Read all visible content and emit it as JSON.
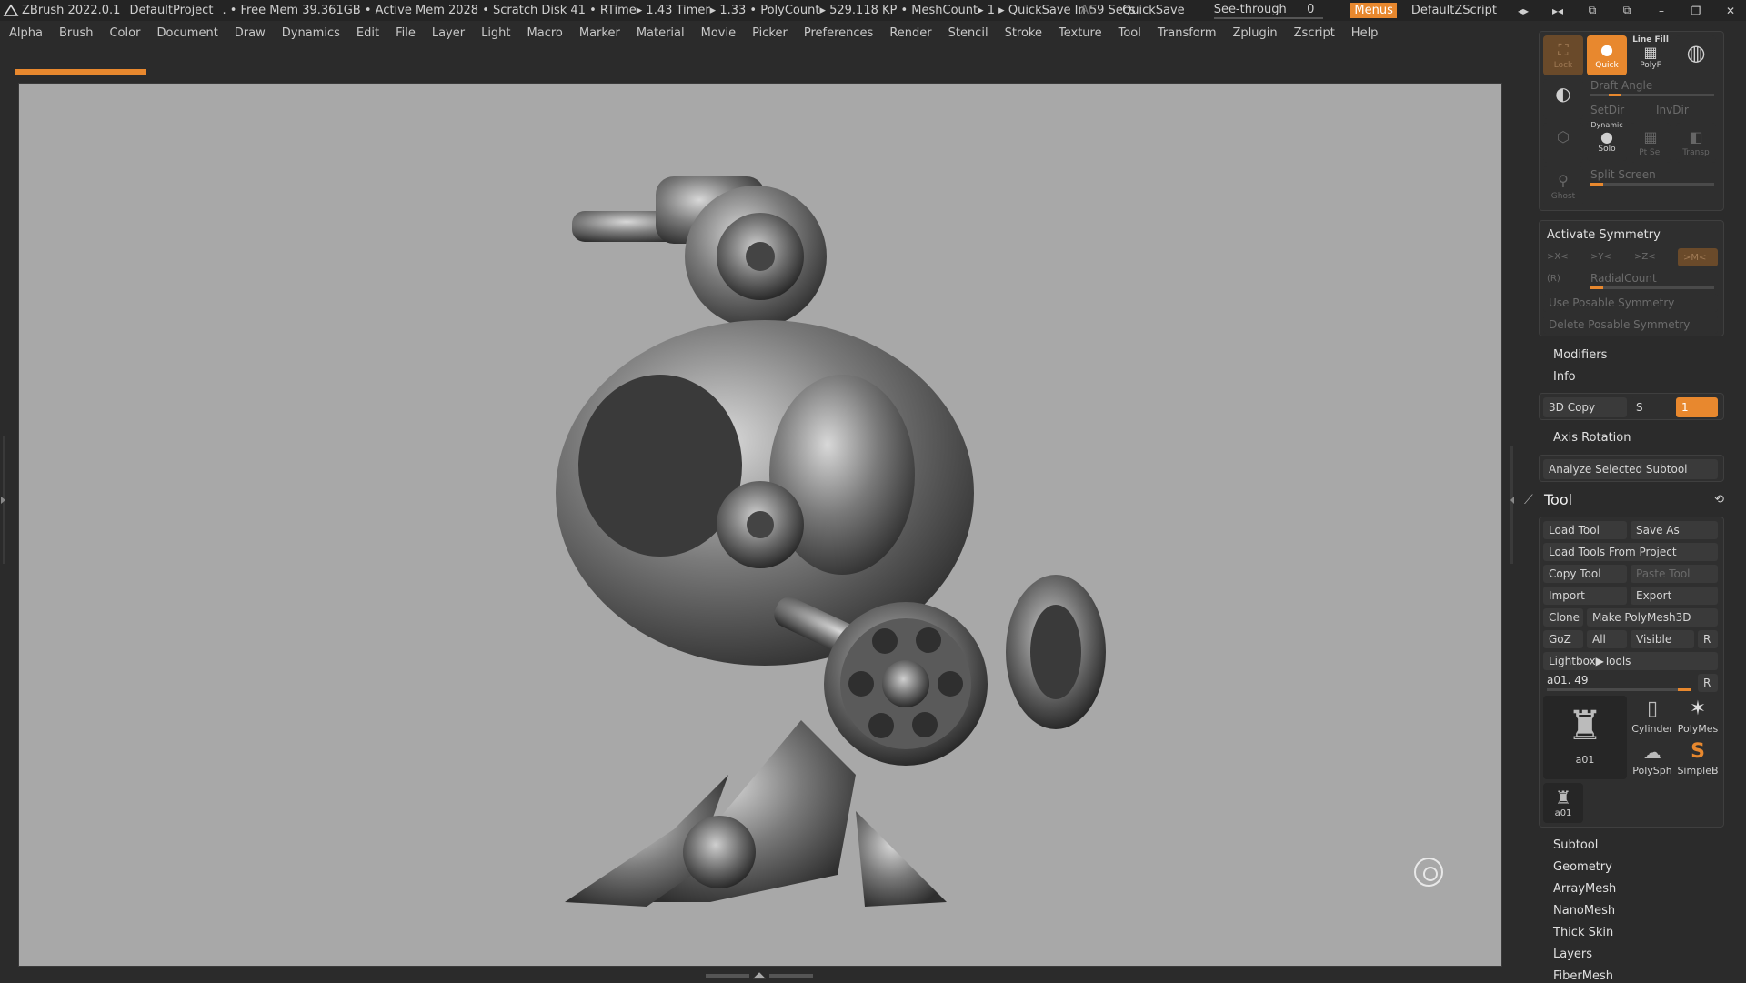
{
  "titlebar": {
    "app": "ZBrush 2022.0.1",
    "project": "DefaultProject",
    "stats": ". • Free Mem 39.361GB • Active Mem 2028 • Scratch Disk 41 •  RTime▸ 1.43 Timer▸ 1.33 • PolyCount▸ 529.118 KP  • MeshCount▸ 1  ▸ QuickSave In 59 Secs",
    "ac": "AC",
    "quicksave": "QuickSave",
    "seethrough": "See-through",
    "seethrough_value": "0",
    "menus": "Menus",
    "zscript": "DefaultZScript"
  },
  "menubar": [
    "Alpha",
    "Brush",
    "Color",
    "Document",
    "Draw",
    "Dynamics",
    "Edit",
    "File",
    "Layer",
    "Light",
    "Macro",
    "Marker",
    "Material",
    "Movie",
    "Picker",
    "Preferences",
    "Render",
    "Stencil",
    "Stroke",
    "Texture",
    "Tool",
    "Transform",
    "Zplugin",
    "Zscript",
    "Help"
  ],
  "progress": {
    "fraction": 0.1
  },
  "panel_top": {
    "lock": "Lock",
    "quick": "Quick",
    "linefill": "Line Fill",
    "polyf": "PolyF",
    "draft_angle": "Draft Angle",
    "setdir": "SetDir",
    "invdir": "InvDir",
    "dynamic": "Dynamic",
    "solo": "Solo",
    "ptsel": "Pt Sel",
    "transp": "Transp",
    "ghost": "Ghost",
    "split_screen": "Split Screen"
  },
  "symmetry": {
    "activate": "Activate Symmetry",
    "x": ">X<",
    "y": ">Y<",
    "z": ">Z<",
    "m": ">M<",
    "r": "(R)",
    "radialcount": "RadialCount",
    "use_posable": "Use Posable Symmetry",
    "delete_posable": "Delete Posable Symmetry"
  },
  "sections": {
    "modifiers": "Modifiers",
    "info": "Info",
    "copy3d": "3D Copy",
    "copy3d_s": "S",
    "copy3d_value": "1",
    "axis_rotation": "Axis Rotation",
    "analyze": "Analyze Selected Subtool"
  },
  "tool": {
    "title": "Tool",
    "load_tool": "Load Tool",
    "save_as": "Save As",
    "load_from_project": "Load Tools From Project",
    "copy_tool": "Copy Tool",
    "paste_tool": "Paste Tool",
    "import": "Import",
    "export": "Export",
    "clone": "Clone",
    "make_polymesh": "Make PolyMesh3D",
    "goz": "GoZ",
    "all": "All",
    "visible": "Visible",
    "r": "R",
    "lightbox": "Lightbox▶Tools",
    "current": "a01. 49",
    "thumbs": {
      "main": "a01",
      "cylinder": "Cylinder",
      "polymesh": "PolyMes",
      "polysphere": "PolySph",
      "simpleb": "SimpleB",
      "small": "a01"
    }
  },
  "subpalettes": [
    "Subtool",
    "Geometry",
    "ArrayMesh",
    "NanoMesh",
    "Thick Skin",
    "Layers",
    "FiberMesh"
  ],
  "colors": {
    "accent": "#e8882e",
    "bg": "#2b2b2b",
    "viewport": "#a8a8a8"
  }
}
